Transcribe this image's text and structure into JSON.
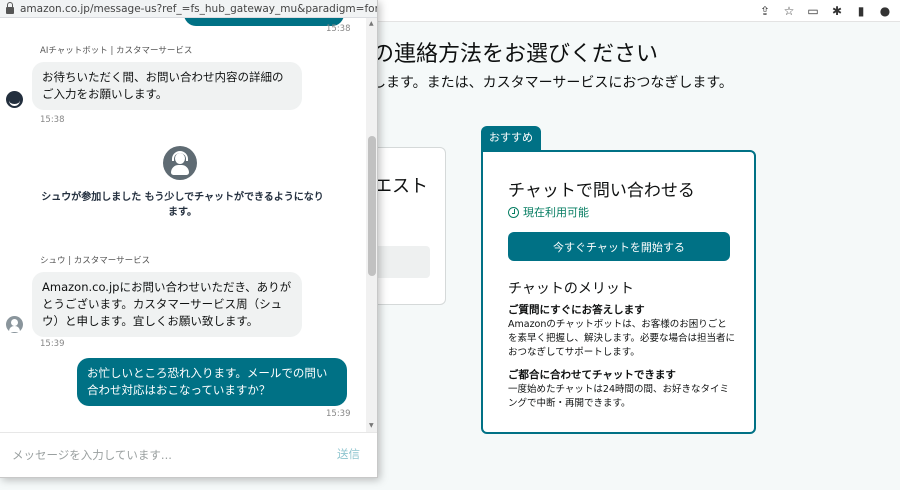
{
  "popup": {
    "url": "amazon.co.jp/message-us?ref_=fs_hub_gateway_mu&paradigm=foresig..."
  },
  "chat": {
    "messages": [
      {
        "timestamp": "15:38"
      },
      {
        "sender": "AIチャットボット | カスタマーサービス",
        "text": "お待ちいただく間、お問い合わせ内容の詳細のご入力をお願いします。",
        "timestamp": "15:38"
      },
      {
        "system": "シュウが参加しました もう少しでチャットができるようになります。"
      },
      {
        "sender": "シュウ | カスタマーサービス",
        "text": "Amazon.co.jpにお問い合わせいただき、ありがとうございます。カスタマーサービス周（シュウ）と申します。宜しくお願い致します。",
        "timestamp": "15:39"
      },
      {
        "text": "お忙しいところ恐れ入ります。メールでの問い合わせ対応はおこなっていますか？",
        "timestamp": "15:39"
      }
    ],
    "input_placeholder": "メッセージを入力しています...",
    "send_label": "送信"
  },
  "background_page": {
    "title": "の連絡方法をお選びください",
    "subtitle": "します。または、カスタマーサービスにおつなぎします。",
    "left_card_title": "エスト",
    "badge": "おすすめ",
    "card": {
      "title": "チャットで問い合わせる",
      "availability": "現在利用可能",
      "button": "今すぐチャットを開始する",
      "benefits_heading": "チャットのメリット",
      "benefit1_title": "ご質問にすぐにお答えします",
      "benefit1_text": "Amazonのチャットボットは、お客様のお困りごとを素早く把握し、解決します。必要な場合は担当者におつなぎしてサポートします。",
      "benefit2_title": "ご都合に合わせてチャットできます",
      "benefit2_text": "一度始めたチャットは24時間の間、お好きなタイミングで中断・再開できます。"
    }
  },
  "colors": {
    "accent": "#007185",
    "available": "#067d62"
  }
}
